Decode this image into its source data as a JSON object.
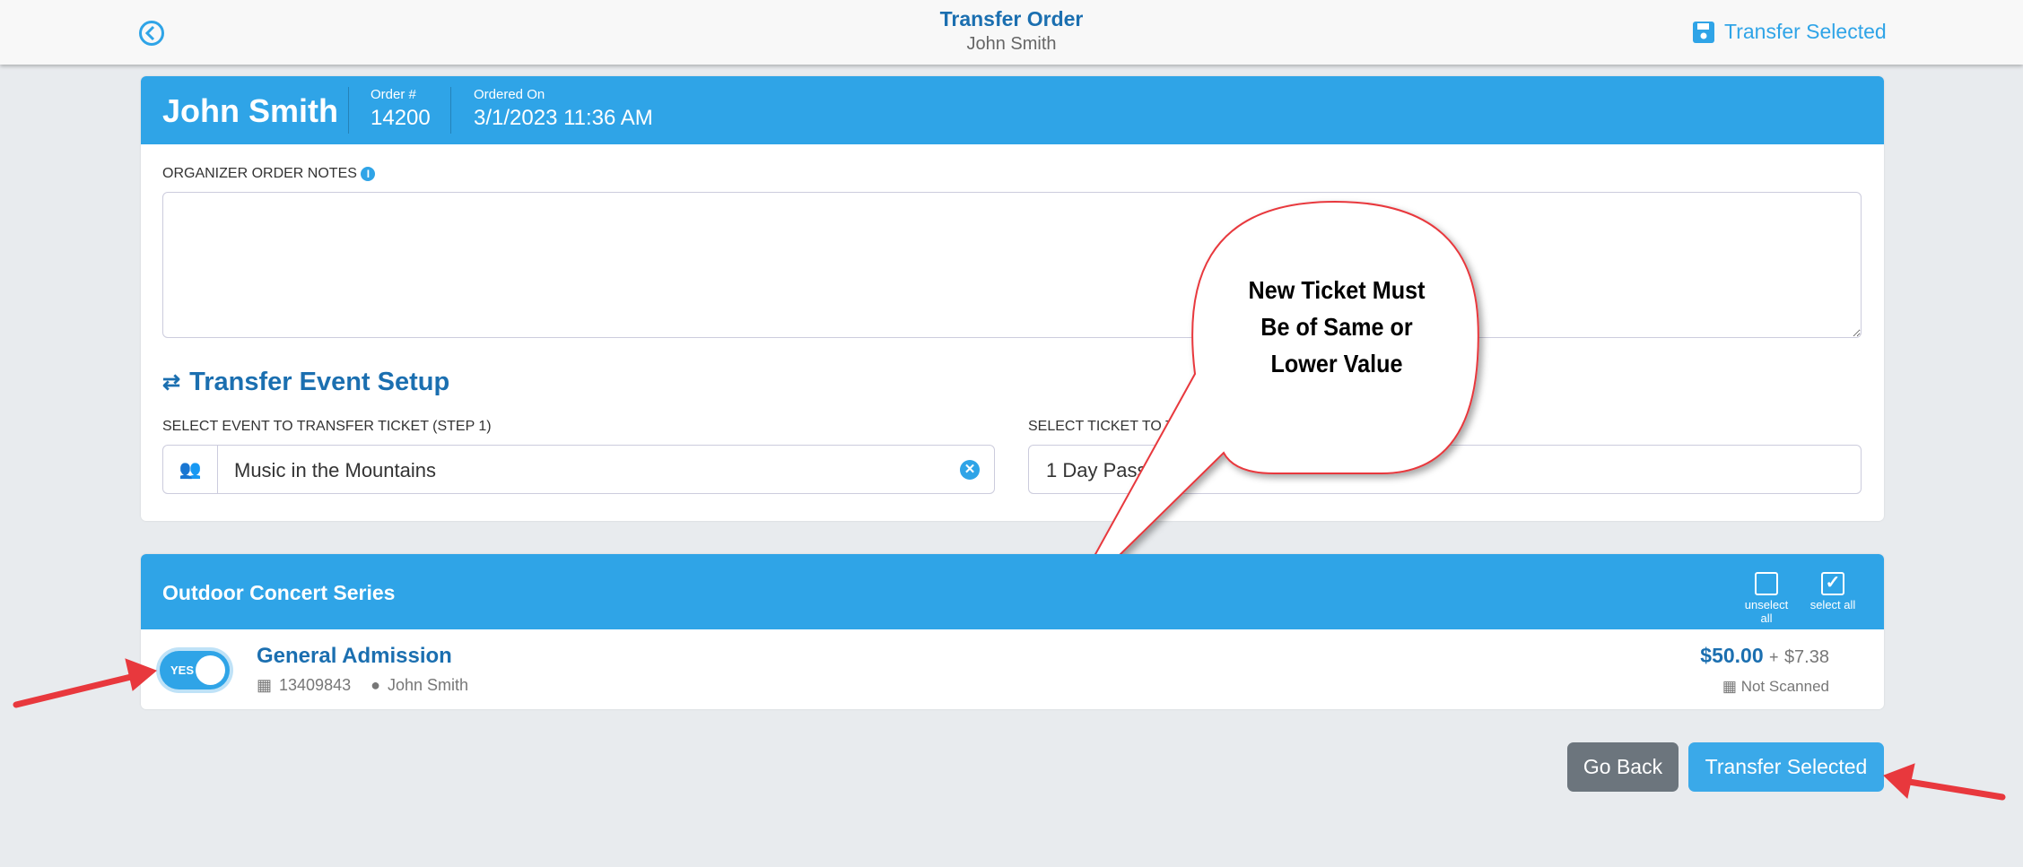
{
  "header": {
    "title": "Transfer Order",
    "subtitle": "John Smith",
    "action_label": "Transfer Selected"
  },
  "order": {
    "customer": "John Smith",
    "order_label": "Order #",
    "order_number": "14200",
    "ordered_label": "Ordered On",
    "ordered_on": "3/1/2023 11:36 AM"
  },
  "notes": {
    "label": "ORGANIZER ORDER NOTES",
    "value": ""
  },
  "setup": {
    "title": "Transfer Event Setup",
    "step1_label": "SELECT EVENT TO TRANSFER TICKET (STEP 1)",
    "step1_value": "Music in the Mountains",
    "step2_label": "SELECT TICKET TO TRANSFER TO (STEP 2)",
    "step2_value": "1 Day Pass"
  },
  "callout": {
    "lines": [
      "New Ticket Must",
      "Be of Same or",
      "Lower Value"
    ]
  },
  "event": {
    "name": "Outdoor Concert Series",
    "unselect_all": "unselect all",
    "select_all": "select all",
    "tickets": [
      {
        "toggle": "YES",
        "name": "General Admission",
        "ticket_id": "13409843",
        "holder": "John Smith",
        "price": "$50.00",
        "plus": "+",
        "fee": "$7.38",
        "scan_status": "Not Scanned"
      }
    ]
  },
  "footer": {
    "back_label": "Go Back",
    "transfer_label": "Transfer Selected"
  },
  "colors": {
    "primary": "#2fa4e7",
    "title": "#1b6fb0",
    "callout_border": "#e8383d",
    "arrow": "#e8383d"
  }
}
